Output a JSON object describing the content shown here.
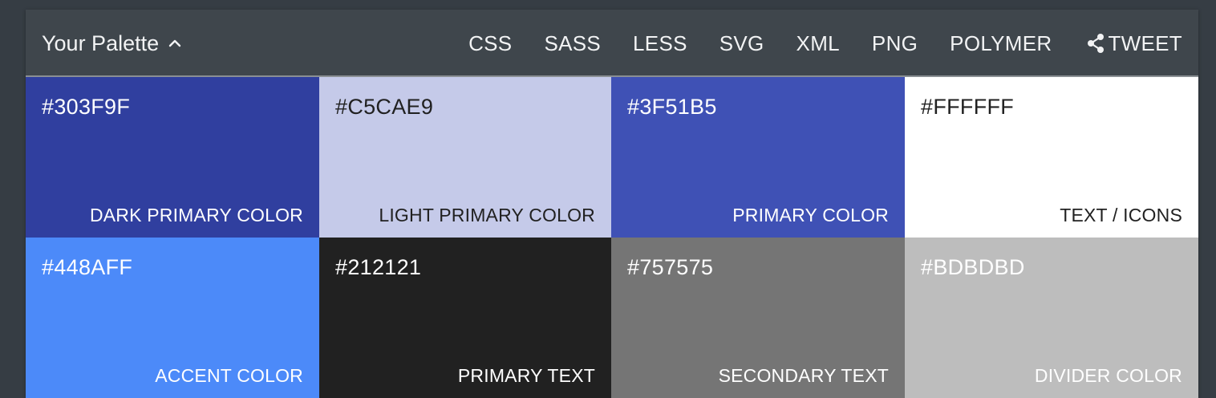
{
  "header": {
    "title": "Your Palette",
    "nav": [
      "CSS",
      "SASS",
      "LESS",
      "SVG",
      "XML",
      "PNG",
      "POLYMER"
    ],
    "tweet_label": "TWEET"
  },
  "swatches": [
    {
      "hex": "#303F9F",
      "label": "DARK PRIMARY COLOR",
      "color": "#303F9F",
      "text_color": "#FFFFFF"
    },
    {
      "hex": "#C5CAE9",
      "label": "LIGHT PRIMARY COLOR",
      "color": "#C5CAE9",
      "text_color": "#212121"
    },
    {
      "hex": "#3F51B5",
      "label": "PRIMARY COLOR",
      "color": "#3F51B5",
      "text_color": "#FFFFFF"
    },
    {
      "hex": "#FFFFFF",
      "label": "TEXT / ICONS",
      "color": "#FFFFFF",
      "text_color": "#212121"
    },
    {
      "hex": "#448AFF",
      "label": "ACCENT COLOR",
      "color": "#4C8AF9",
      "text_color": "#FFFFFF"
    },
    {
      "hex": "#212121",
      "label": "PRIMARY TEXT",
      "color": "#212121",
      "text_color": "#FFFFFF"
    },
    {
      "hex": "#757575",
      "label": "SECONDARY TEXT",
      "color": "#757575",
      "text_color": "#FFFFFF"
    },
    {
      "hex": "#BDBDBD",
      "label": "DIVIDER COLOR",
      "color": "#BDBDBD",
      "text_color": "#FFFFFF"
    }
  ],
  "icons": {
    "caret": "chevron-up-icon",
    "share": "share-icon"
  },
  "colors": {
    "background": "#363D44",
    "header": "#3F464C",
    "header_text": "#F2F3F4"
  }
}
